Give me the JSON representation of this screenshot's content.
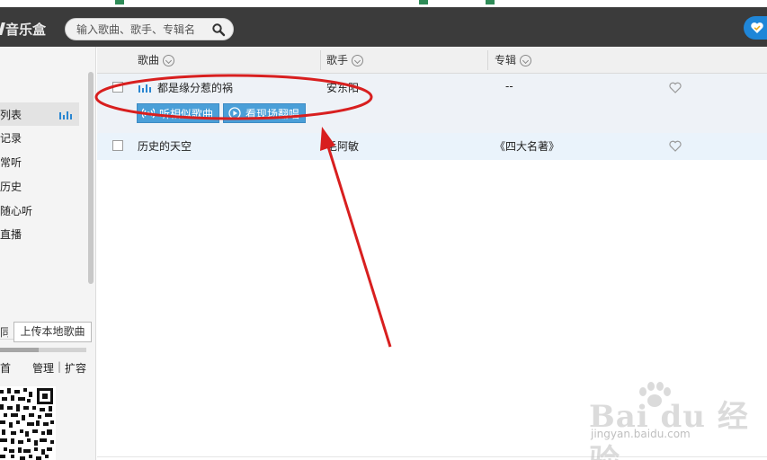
{
  "app": {
    "logo_text": "音乐盒"
  },
  "search": {
    "placeholder": "输入歌曲、歌手、专辑名"
  },
  "sidebar": {
    "items": [
      {
        "label": "列表",
        "active": true
      },
      {
        "label": "记录"
      },
      {
        "label": "常听"
      },
      {
        "label": "历史"
      },
      {
        "label": "随心听"
      },
      {
        "label": "直播"
      }
    ],
    "left_button_label": "同",
    "upload_label": "上传本地歌曲",
    "progress": 0.45,
    "footer_left": "首",
    "footer_manage": "管理",
    "footer_sep": "|",
    "footer_expand": "扩容"
  },
  "table": {
    "columns": [
      {
        "label": "歌曲"
      },
      {
        "label": "歌手"
      },
      {
        "label": "专辑"
      }
    ],
    "rows": [
      {
        "title": "都是缘分惹的祸",
        "artist": "安东阳",
        "album": "--",
        "playing": true,
        "actions": [
          {
            "label": "听相似歌曲",
            "icon": "radio-wave-icon"
          },
          {
            "label": "看现场翻唱",
            "icon": "play-circle-icon"
          }
        ]
      },
      {
        "title": "历史的天空",
        "artist": "毛阿敏",
        "album": "《四大名著》",
        "playing": false
      }
    ]
  },
  "colors": {
    "topbar": "#3b3b3b",
    "accent_blue": "#4a9fd8",
    "annotation_red": "#d81f1f"
  },
  "watermark": {
    "brand": "Bai du 经验",
    "url": "jingyan.baidu.com"
  }
}
